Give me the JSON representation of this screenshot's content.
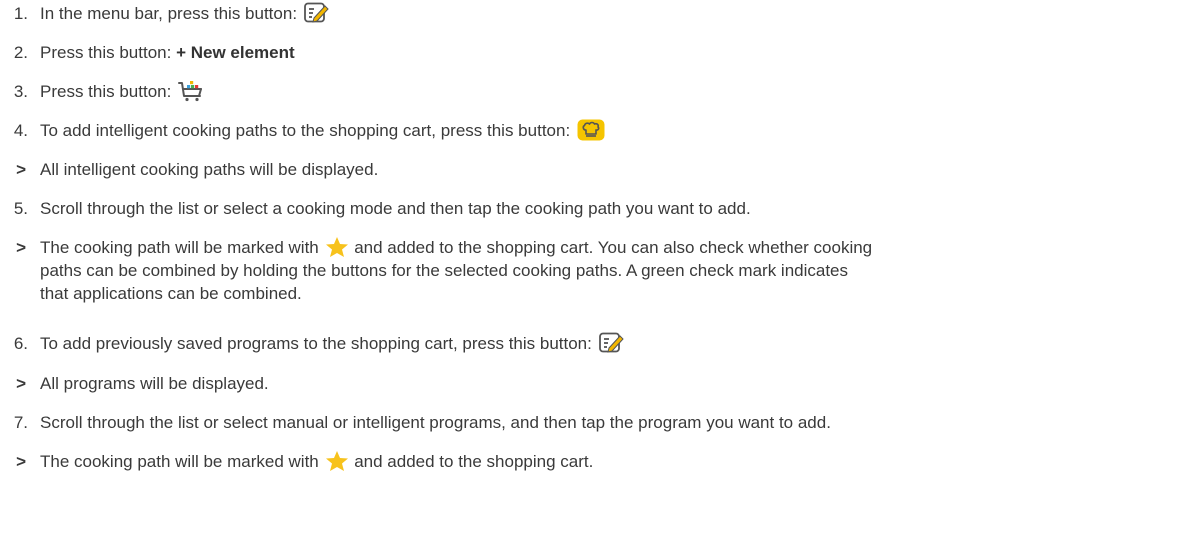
{
  "steps": [
    {
      "marker": "1.",
      "text": "In the menu bar, press this button: ",
      "icon": "edit-list-icon"
    },
    {
      "marker": "2.",
      "text": "Press this button: ",
      "bold": "+ New element"
    },
    {
      "marker": "3.",
      "text": "Press this button: ",
      "icon": "shopping-cart-icon"
    },
    {
      "marker": "4.",
      "text": "To add intelligent cooking paths to the shopping cart, press this button: ",
      "icon": "chef-hat-icon"
    },
    {
      "marker": ">",
      "text": "All intelligent cooking paths will be displayed."
    },
    {
      "marker": "5.",
      "text": "Scroll through the list or select a cooking mode and then tap the cooking path you want to add."
    },
    {
      "marker": ">",
      "text_before": "The cooking path will be marked with ",
      "icon": "star-icon",
      "text_after_line1": " and added to the shopping cart. You can also check whether cooking",
      "line2": "paths can be combined by holding the buttons for the selected cooking paths. A green check mark indicates",
      "line3": "that applications can be combined."
    },
    {
      "marker": "6.",
      "text": "To add previously saved programs to the shopping cart, press this button: ",
      "icon": "edit-list-icon"
    },
    {
      "marker": ">",
      "text": "All programs will be displayed."
    },
    {
      "marker": "7.",
      "text": "Scroll through the list or select manual or intelligent programs, and then tap the program you want to add."
    },
    {
      "marker": ">",
      "text_before": "The cooking path will be marked with ",
      "icon": "star-icon",
      "text_after": " and added to the shopping cart."
    }
  ],
  "colors": {
    "text": "#3a3a3a",
    "star": "#f7c21c",
    "chef_badge": "#f5c400",
    "edit_icon": "#555555",
    "edit_pencil": "#f2b600",
    "cart_dots": [
      "#f2b600",
      "#3aa0dc",
      "#4caf50",
      "#e53935"
    ]
  }
}
